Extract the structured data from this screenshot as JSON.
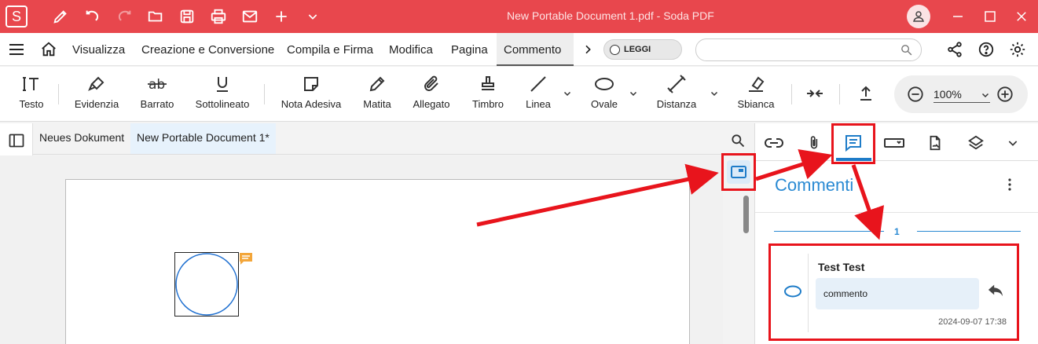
{
  "app": {
    "window_title": "New Portable Document 1.pdf  -  Soda PDF",
    "logo_letter": "S"
  },
  "menu": {
    "items": [
      "Visualizza",
      "Creazione e Conversione",
      "Compila e Firma",
      "Modifica",
      "Pagina",
      "Commento"
    ],
    "active": "Commento",
    "leggi_label": "LEGGI",
    "search_placeholder": ""
  },
  "toolbar": {
    "tools": {
      "testo": "Testo",
      "evidenzia": "Evidenzia",
      "barrato": "Barrato",
      "sottolineato": "Sottolineato",
      "nota_adesiva": "Nota Adesiva",
      "matita": "Matita",
      "allegato": "Allegato",
      "timbro": "Timbro",
      "linea": "Linea",
      "ovale": "Ovale",
      "distanza": "Distanza",
      "sbianca": "Sbianca"
    },
    "zoom": "100%"
  },
  "doc_tabs": [
    "Neues Dokument",
    "New Portable Document 1*"
  ],
  "panel": {
    "title": "Commenti",
    "page_number": "1",
    "comment": {
      "author": "Test Test",
      "text": "commento",
      "date": "2024-09-07 17:38"
    }
  },
  "colors": {
    "brand": "#e8474d",
    "accent": "#2a8ad3",
    "highlight": "#e8141c"
  }
}
